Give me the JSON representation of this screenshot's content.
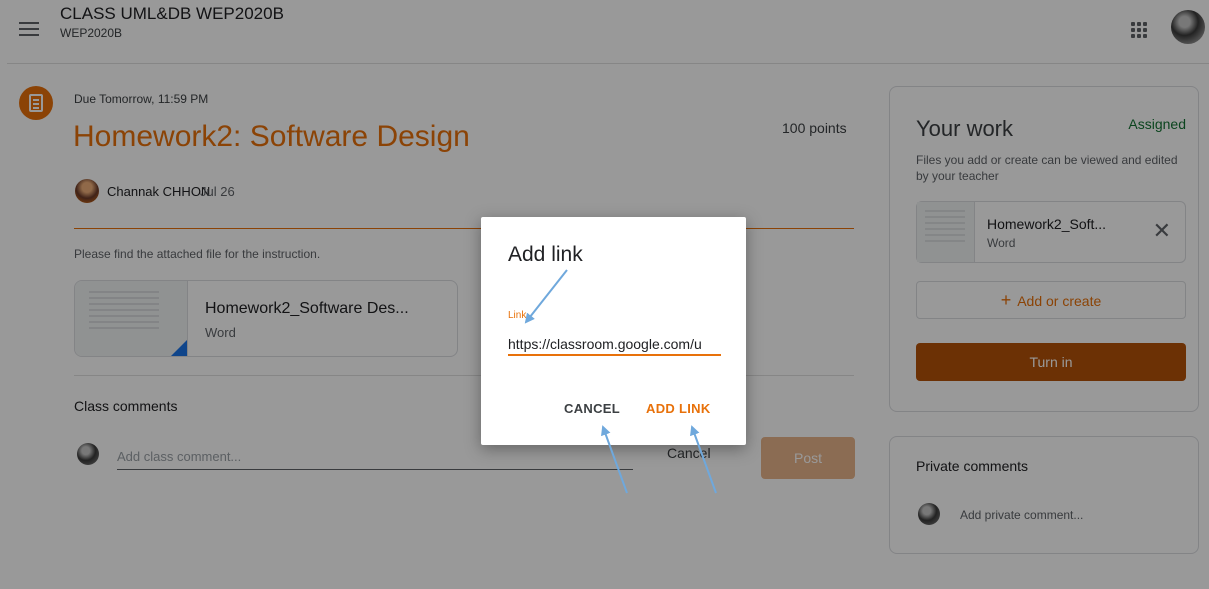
{
  "header": {
    "class_name": "CLASS UML&DB WEP2020B",
    "section": "WEP2020B"
  },
  "assignment": {
    "due": "Due Tomorrow, 11:59 PM",
    "title": "Homework2: Software Design",
    "points": "100 points",
    "author": "Channak CHHON",
    "posted_date": "Jul 26",
    "instructions": "Please find the attached file for the instruction.",
    "attachment": {
      "name": "Homework2_Software Des...",
      "type": "Word"
    }
  },
  "class_comments": {
    "label": "Class comments",
    "placeholder": "Add class comment...",
    "cancel_label": "Cancel",
    "post_label": "Post"
  },
  "your_work": {
    "title": "Your work",
    "status": "Assigned",
    "status_color": "#137333",
    "description": "Files you add or create can be viewed and edited by your teacher",
    "file": {
      "name": "Homework2_Soft...",
      "type": "Word"
    },
    "add_label": "Add or create",
    "turn_in_label": "Turn in"
  },
  "private_comments": {
    "title": "Private comments",
    "placeholder": "Add private comment..."
  },
  "dialog": {
    "title": "Add link",
    "field_label": "Link",
    "field_value": "https://classroom.google.com/u",
    "cancel_label": "CANCEL",
    "add_label": "ADD LINK"
  },
  "colors": {
    "accent": "#e8710a",
    "turn_in": "#b45309",
    "annotation_arrow": "#6fa8dc"
  },
  "icons": [
    "menu-icon",
    "apps-grid-icon",
    "assignment-icon",
    "close-icon",
    "plus-icon"
  ]
}
